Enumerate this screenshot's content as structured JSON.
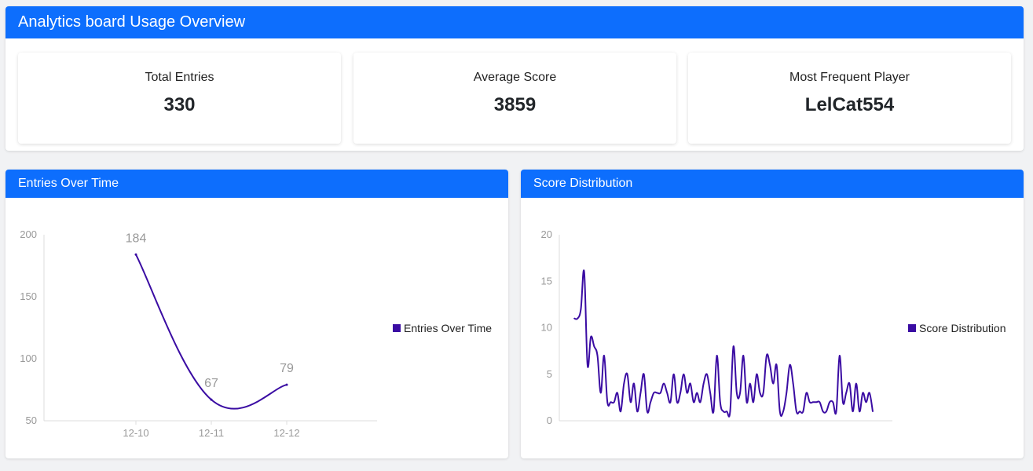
{
  "overview": {
    "title": "Analytics board Usage Overview",
    "stats": [
      {
        "label": "Total Entries",
        "value": "330"
      },
      {
        "label": "Average Score",
        "value": "3859"
      },
      {
        "label": "Most Frequent Player",
        "value": "LelCat554"
      }
    ]
  },
  "colors": {
    "header": "#0d6efd",
    "series": "#3a0ca3",
    "tick": "#999999"
  },
  "entries_chart": {
    "title": "Entries Over Time",
    "legend": "Entries Over Time",
    "chart_data": {
      "type": "line",
      "categories": [
        "12-10",
        "12-11",
        "12-12"
      ],
      "values": [
        184,
        67,
        79
      ],
      "data_labels": [
        "184",
        "67",
        "79"
      ],
      "ylim": [
        50,
        200
      ],
      "yticks": [
        "50",
        "100",
        "150",
        "200"
      ],
      "legend_position": "right"
    }
  },
  "score_chart": {
    "title": "Score Distribution",
    "legend": "Score Distribution",
    "chart_data": {
      "type": "line",
      "values": [
        11,
        11,
        12,
        16,
        6,
        9,
        8,
        7,
        3,
        7,
        2,
        2,
        2,
        3,
        1,
        4,
        5,
        2,
        4,
        1,
        3,
        5,
        1,
        2,
        3,
        3,
        3,
        4,
        3,
        2,
        5,
        2,
        3,
        5,
        3,
        4,
        2,
        3,
        2,
        4,
        5,
        3,
        1,
        7,
        2,
        1,
        1,
        1,
        8,
        3,
        3,
        7,
        2,
        4,
        2,
        5,
        3,
        3,
        7,
        6,
        4,
        6,
        1,
        1,
        3,
        6,
        4,
        1,
        1,
        1,
        3,
        2,
        2,
        2,
        2,
        1,
        1,
        2,
        2,
        1,
        7,
        2,
        3,
        4,
        1,
        4,
        1,
        3,
        2,
        3,
        1
      ],
      "ylim": [
        0,
        20
      ],
      "yticks": [
        "0",
        "5",
        "10",
        "15",
        "20"
      ],
      "legend_position": "right"
    }
  }
}
